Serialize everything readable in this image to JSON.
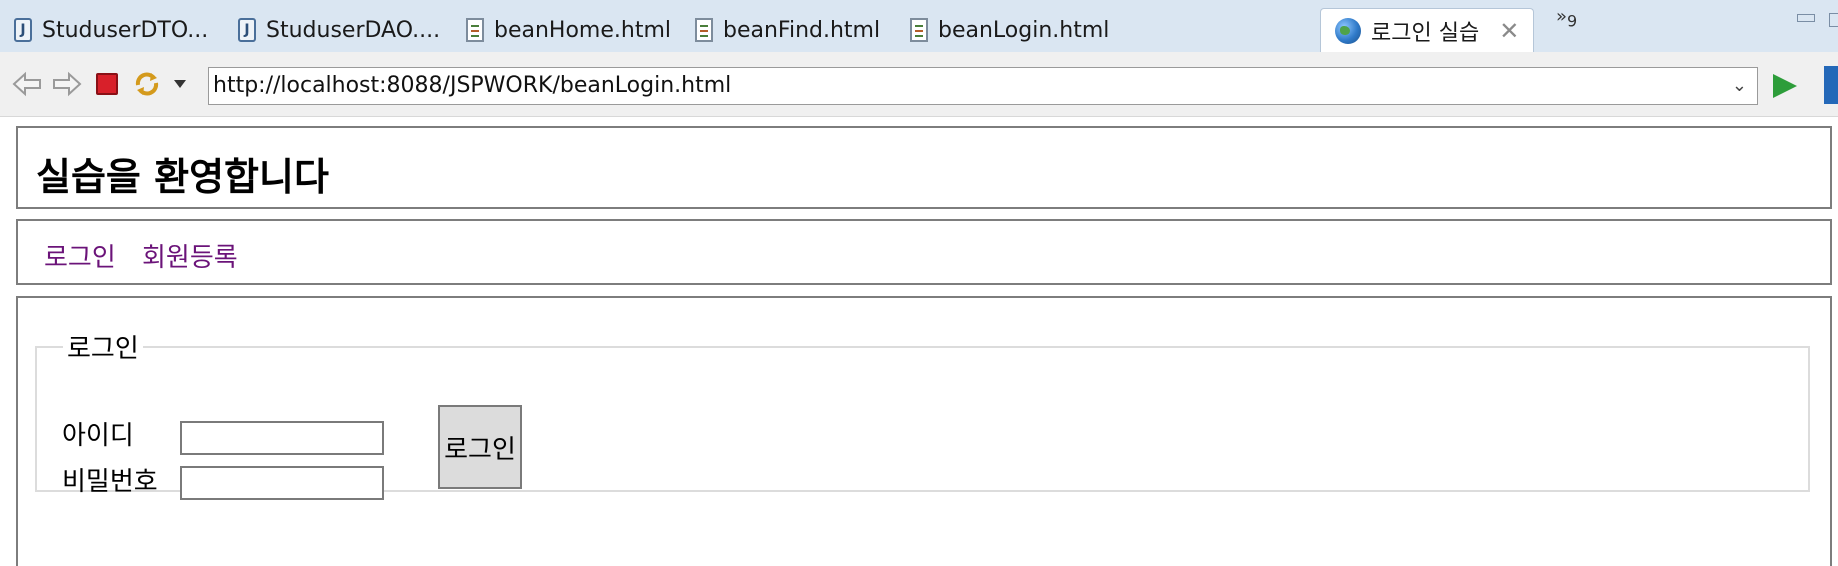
{
  "editor_tabs": [
    {
      "label": "StuduserDTO...",
      "icon": "java-file-icon",
      "active": false
    },
    {
      "label": "StuduserDAO....",
      "icon": "java-file-icon",
      "active": false
    },
    {
      "label": "beanHome.html",
      "icon": "html-file-icon",
      "active": false
    },
    {
      "label": "beanFind.html",
      "icon": "html-file-icon",
      "active": false
    },
    {
      "label": "beanLogin.html",
      "icon": "html-file-icon",
      "active": false
    },
    {
      "label": "로그인 실습",
      "icon": "globe-icon",
      "active": true
    }
  ],
  "overflow_tabs": {
    "symbol": "»",
    "count": "9"
  },
  "browser": {
    "url": "http://localhost:8088/JSPWORK/beanLogin.html"
  },
  "page": {
    "header_title": "실습을 환영합니다",
    "nav": [
      "로그인",
      "회원등록"
    ],
    "login_form": {
      "legend": "로그인",
      "id_label": "아이디",
      "password_label": "비밀번호",
      "id_value": "",
      "password_value": "",
      "submit_label": "로그인"
    }
  },
  "colors": {
    "tabbar_bg": "#dae6f2",
    "nav_link": "#6b1379",
    "stop_button": "#d8202a",
    "go_button": "#2d9d3a"
  }
}
